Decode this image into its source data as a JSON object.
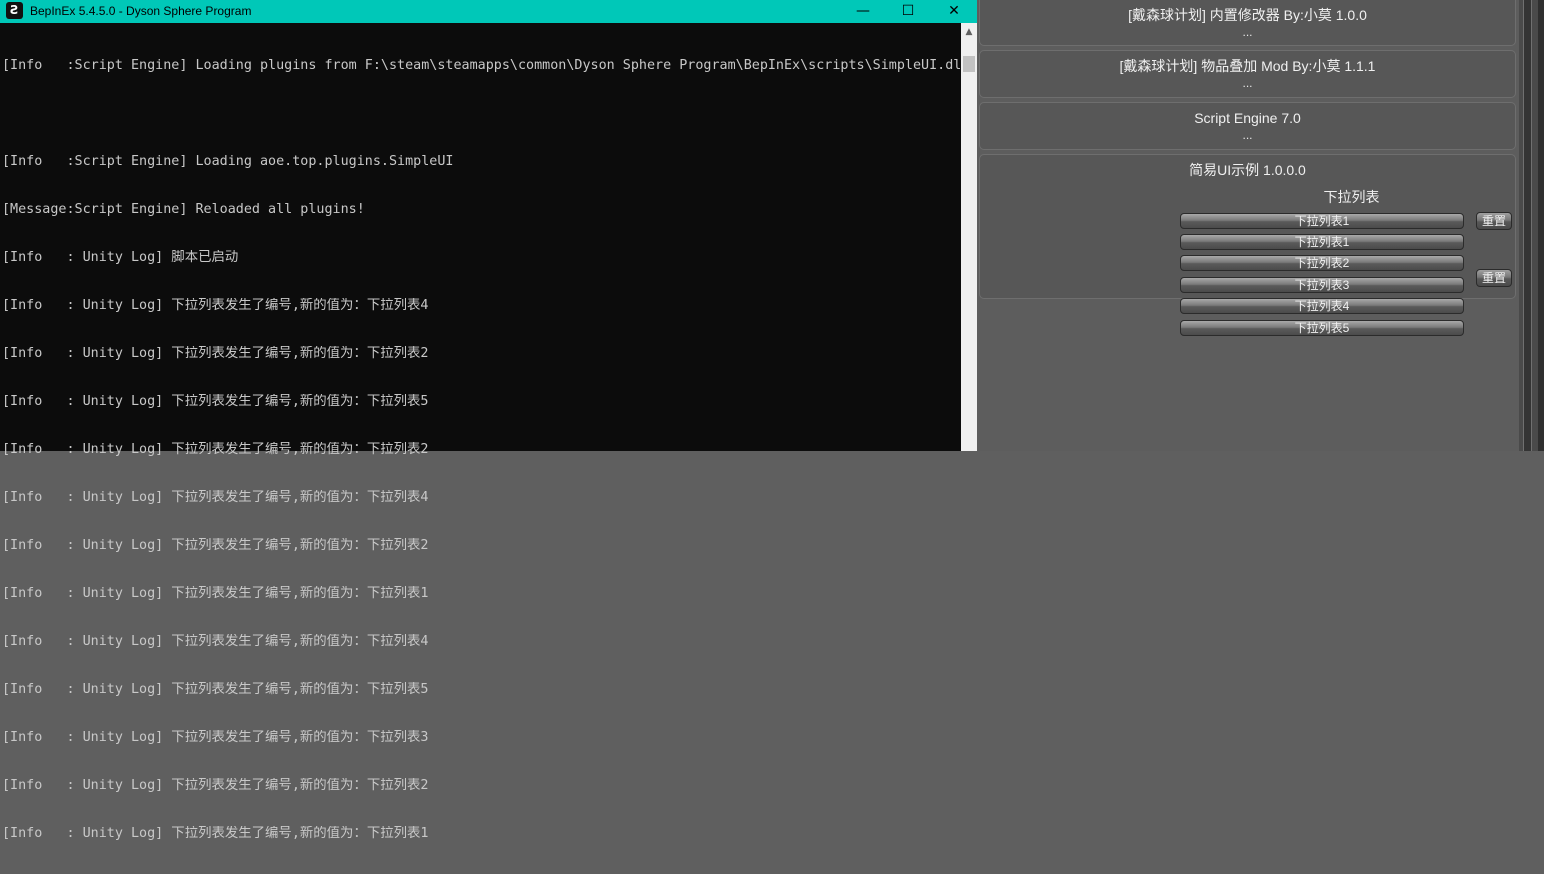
{
  "console": {
    "title": "BepInEx 5.4.5.0 - Dyson Sphere Program",
    "icon": "bepinex-icon",
    "controls": {
      "minimize": "—",
      "maximize": "☐",
      "close": "✕"
    },
    "log_lines": [
      "[Info   :Script Engine] Loading plugins from F:\\steam\\steamapps\\common\\Dyson Sphere Program\\BepInEx\\scripts\\SimpleUI.dll",
      "",
      "[Info   :Script Engine] Loading aoe.top.plugins.SimpleUI",
      "[Message:Script Engine] Reloaded all plugins!",
      "[Info   : Unity Log] 脚本已启动",
      "[Info   : Unity Log] 下拉列表发生了编号,新的值为：下拉列表4",
      "[Info   : Unity Log] 下拉列表发生了编号,新的值为：下拉列表2",
      "[Info   : Unity Log] 下拉列表发生了编号,新的值为：下拉列表5",
      "[Info   : Unity Log] 下拉列表发生了编号,新的值为：下拉列表2",
      "[Info   : Unity Log] 下拉列表发生了编号,新的值为：下拉列表4",
      "[Info   : Unity Log] 下拉列表发生了编号,新的值为：下拉列表2",
      "[Info   : Unity Log] 下拉列表发生了编号,新的值为：下拉列表1",
      "[Info   : Unity Log] 下拉列表发生了编号,新的值为：下拉列表4",
      "[Info   : Unity Log] 下拉列表发生了编号,新的值为：下拉列表5",
      "[Info   : Unity Log] 下拉列表发生了编号,新的值为：下拉列表3",
      "[Info   : Unity Log] 下拉列表发生了编号,新的值为：下拉列表2",
      "[Info   : Unity Log] 下拉列表发生了编号,新的值为：下拉列表1"
    ]
  },
  "plugins": [
    {
      "label": "[戴森球计划] 内置修改器 By:小莫 1.0.0",
      "dots": "..."
    },
    {
      "label": "[戴森球计划] 物品叠加 Mod By:小莫 1.1.1",
      "dots": "..."
    },
    {
      "label": "Script Engine 7.0",
      "dots": "..."
    },
    {
      "label": "简易UI示例 1.0.0.0",
      "subtitle": "下拉列表"
    }
  ],
  "dropdown": {
    "selected": "下拉列表1",
    "options": [
      "下拉列表1",
      "下拉列表2",
      "下拉列表3",
      "下拉列表4",
      "下拉列表5"
    ],
    "reset_label": "重置"
  },
  "colors": {
    "titlebar": "#00c8b8",
    "console_bg": "#0c0c0c",
    "console_text": "#c8c8c8",
    "panel_bg": "#575757"
  }
}
